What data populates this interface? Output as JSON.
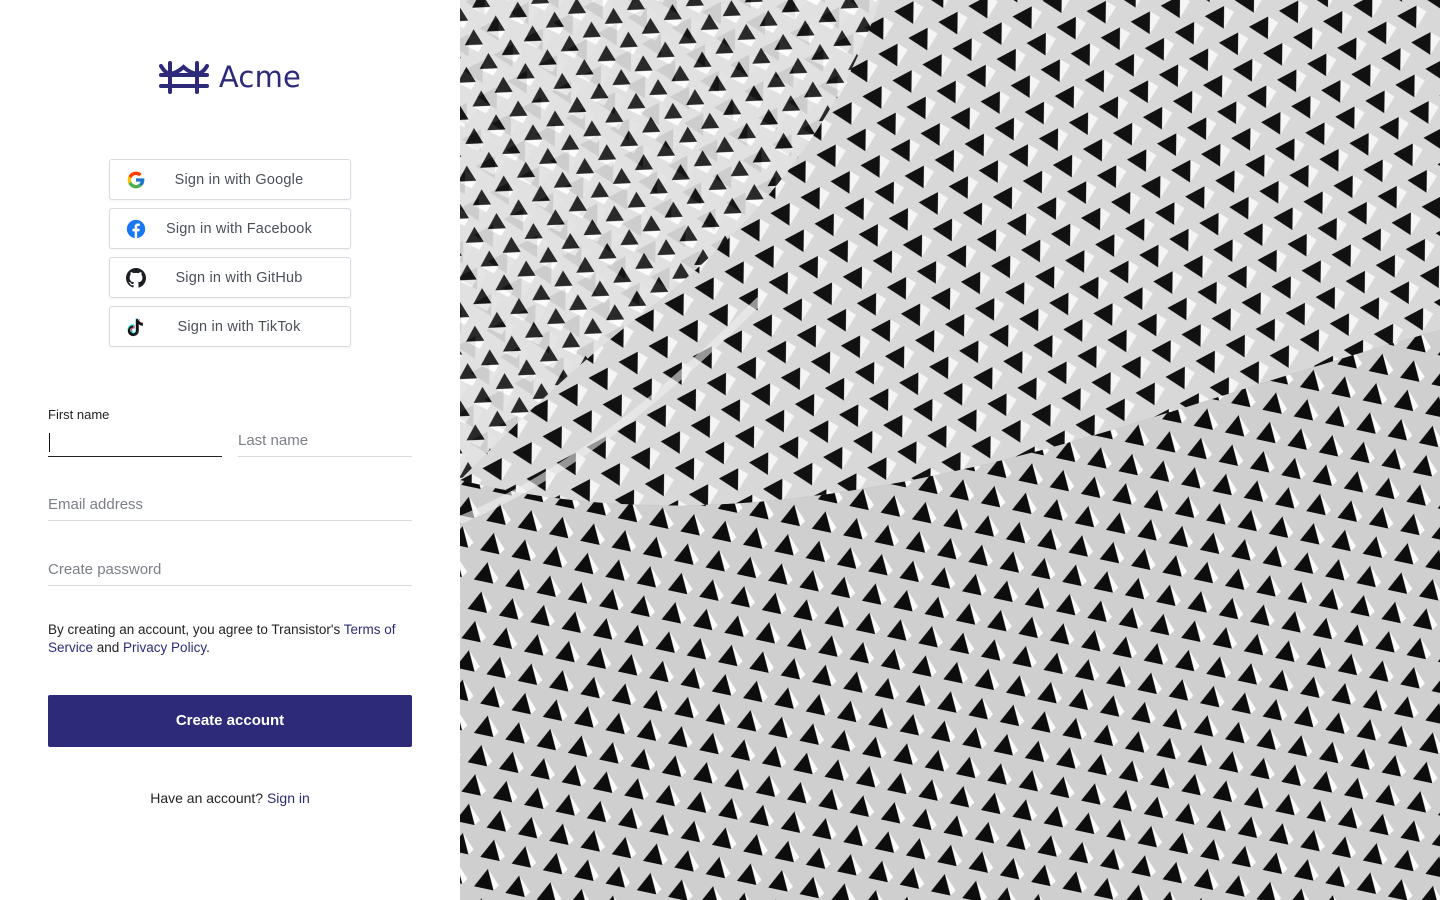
{
  "brand": {
    "name": "Acme",
    "color": "#2d2a7a"
  },
  "social": [
    {
      "label": "Sign in with Google",
      "icon": "google-icon"
    },
    {
      "label": "Sign in with Facebook",
      "icon": "facebook-icon"
    },
    {
      "label": "Sign in with GitHub",
      "icon": "github-icon"
    },
    {
      "label": "Sign in with TikTok",
      "icon": "tiktok-icon"
    }
  ],
  "form": {
    "first_name_label": "First name",
    "first_name_value": "",
    "last_name_placeholder": "Last name",
    "email_placeholder": "Email address",
    "password_placeholder": "Create password",
    "terms_prefix": "By creating an account, you agree to Transistor's ",
    "terms_link": "Terms of Service",
    "terms_and": " and ",
    "privacy_link": "Privacy Policy",
    "terms_suffix": ".",
    "submit_label": "Create account"
  },
  "footer": {
    "prompt": "Have an account? ",
    "signin_link": "Sign in"
  },
  "hero": {
    "image": "abstract-geometric-facade-bw"
  }
}
